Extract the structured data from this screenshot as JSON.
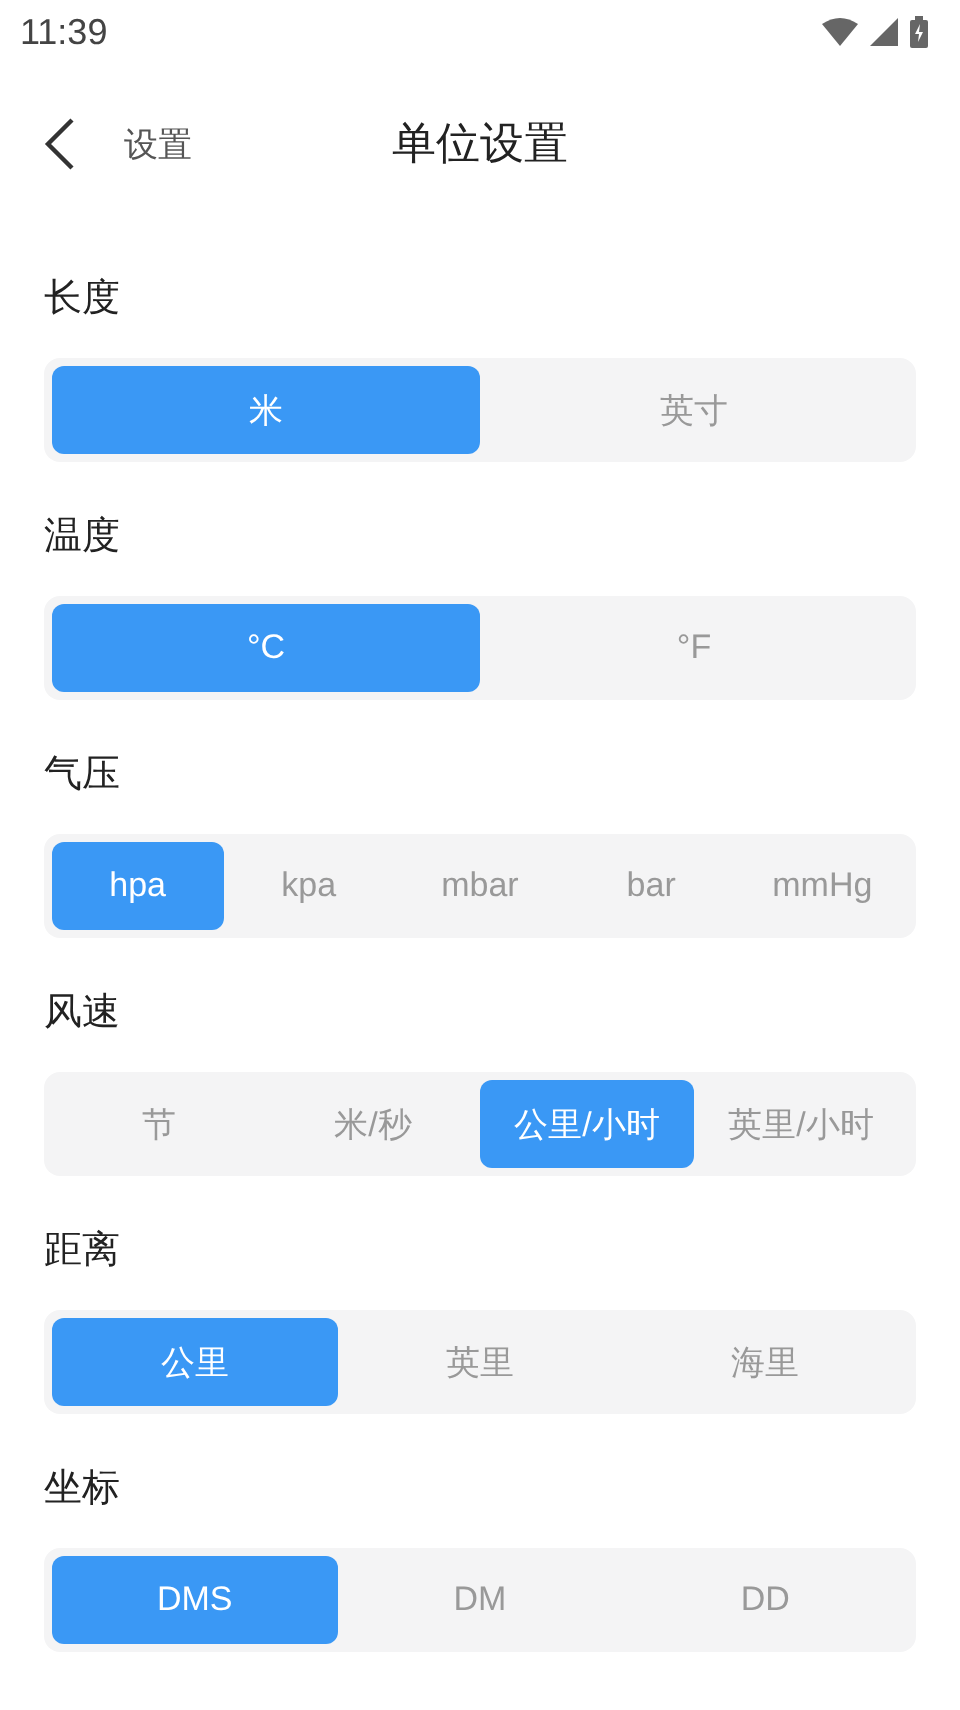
{
  "status_bar": {
    "time": "11:39"
  },
  "header": {
    "back_label": "设置",
    "title": "单位设置"
  },
  "sections": [
    {
      "label": "长度",
      "options": [
        {
          "label": "米",
          "selected": true
        },
        {
          "label": "英寸",
          "selected": false
        }
      ]
    },
    {
      "label": "温度",
      "options": [
        {
          "label": "°C",
          "selected": true
        },
        {
          "label": "°F",
          "selected": false
        }
      ]
    },
    {
      "label": "气压",
      "options": [
        {
          "label": "hpa",
          "selected": true
        },
        {
          "label": "kpa",
          "selected": false
        },
        {
          "label": "mbar",
          "selected": false
        },
        {
          "label": "bar",
          "selected": false
        },
        {
          "label": "mmHg",
          "selected": false
        }
      ]
    },
    {
      "label": "风速",
      "options": [
        {
          "label": "节",
          "selected": false
        },
        {
          "label": "米/秒",
          "selected": false
        },
        {
          "label": "公里/小时",
          "selected": true
        },
        {
          "label": "英里/小时",
          "selected": false
        }
      ]
    },
    {
      "label": "距离",
      "options": [
        {
          "label": "公里",
          "selected": true
        },
        {
          "label": "英里",
          "selected": false
        },
        {
          "label": "海里",
          "selected": false
        }
      ]
    },
    {
      "label": "坐标",
      "options": [
        {
          "label": "DMS",
          "selected": true
        },
        {
          "label": "DM",
          "selected": false
        },
        {
          "label": "DD",
          "selected": false
        }
      ]
    }
  ]
}
